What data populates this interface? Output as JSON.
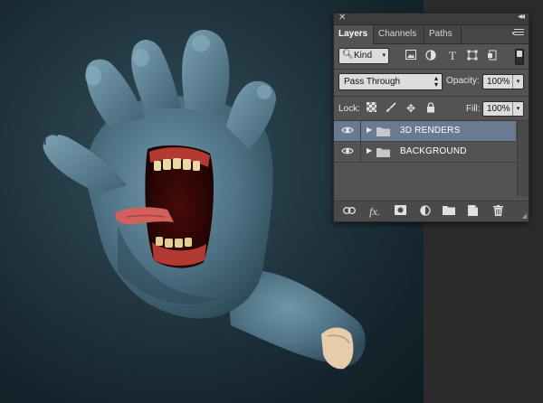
{
  "panel": {
    "tabs": [
      {
        "label": "Layers",
        "active": true
      },
      {
        "label": "Channels",
        "active": false
      },
      {
        "label": "Paths",
        "active": false
      }
    ],
    "filter": {
      "kind_label": "Kind",
      "filter_icons": [
        "image-filter-icon",
        "adjustment-filter-icon",
        "type-filter-icon",
        "shape-filter-icon",
        "smart-object-filter-icon"
      ]
    },
    "blend_mode": "Pass Through",
    "opacity_label": "Opacity:",
    "opacity_value": "100%",
    "lock_label": "Lock:",
    "fill_label": "Fill:",
    "fill_value": "100%",
    "layers": [
      {
        "name": "3D RENDERS",
        "type": "group",
        "visible": true,
        "selected": true
      },
      {
        "name": "BACKGROUND",
        "type": "group",
        "visible": true,
        "selected": false
      }
    ],
    "bottom_icons": [
      "link-layers-icon",
      "fx-icon",
      "add-mask-icon",
      "adjustment-layer-icon",
      "new-group-icon",
      "new-layer-icon",
      "delete-icon"
    ]
  },
  "colors": {
    "panel_bg": "#535353",
    "selected_layer": "#6b7a93",
    "pasteboard": "#2b2b2b"
  }
}
